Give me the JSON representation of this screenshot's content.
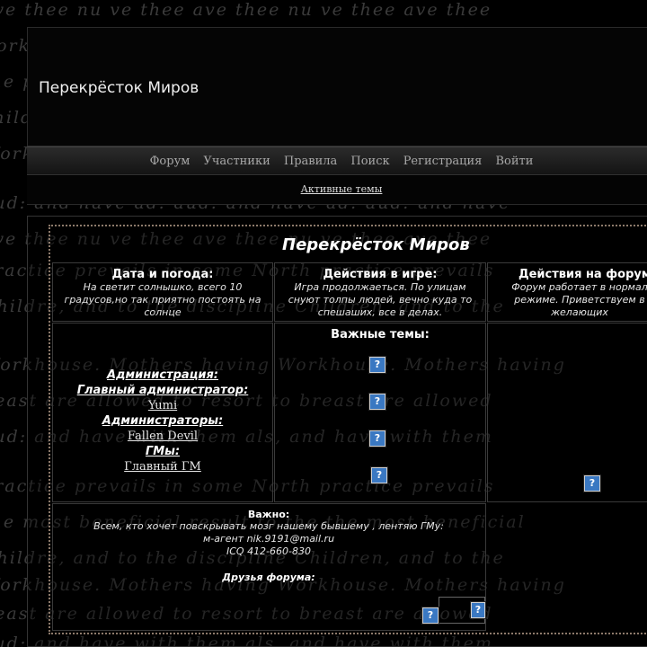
{
  "header": {
    "site_title": "Перекрёсток Миров"
  },
  "nav": {
    "items": [
      "Форум",
      "Участники",
      "Правила",
      "Поиск",
      "Регистрация",
      "Войти"
    ]
  },
  "active_topics": "Активные темы",
  "board": {
    "title": "Перекрёсток Миров",
    "weather": {
      "heading": "Дата и погода:",
      "text": "На светит солнышко, всего 10 градусов,но так приятно постоять на солнце"
    },
    "game_actions": {
      "heading": "Действия в игре:",
      "text": "Игра продолжаеться. По улицам снуют толпы людей, вечно куда то спешаших, все в делах."
    },
    "forum_actions": {
      "heading": "Действия на форум",
      "text": "Форум работает в нормал режиме. Приветствуем в желающих"
    },
    "important_topics": {
      "heading": "Важные темы:"
    },
    "admin": {
      "administration": "Администрация:",
      "main_admin_label": "Главный администратор:",
      "main_admin": "Yumi",
      "admins_label": "Администраторы:",
      "admin_1": "Fallen Devil",
      "gms_label": "ГМы:",
      "gm_1": "Главный ГМ"
    },
    "notice": {
      "title": "Важно:",
      "line1": "Всем, кто хочет повскрывать мозг нашему бывшему , лентяю ГМу:",
      "line2": "м-агент nik.9191@mail.ru",
      "line3": "ICQ 412-660-830"
    },
    "friends_label": "Друзья форума:"
  },
  "icons": {
    "broken_image": "question-image-icon",
    "glyph": "?"
  },
  "colors": {
    "background": "#000000",
    "board_border": "#8d7a6b",
    "nav_text": "#a8a8a8",
    "icon_blue": "#3a78c2"
  }
}
